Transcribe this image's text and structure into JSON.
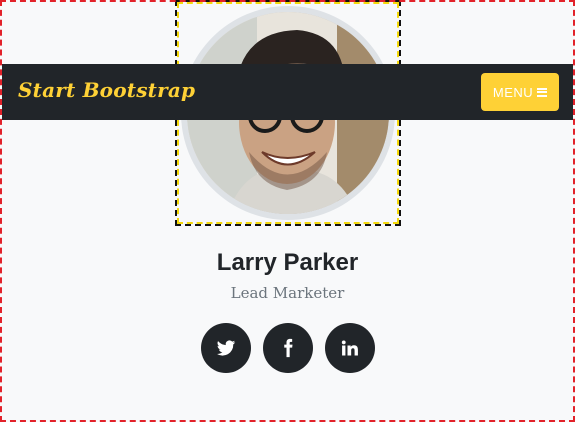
{
  "navbar": {
    "brand": "Start Bootstrap",
    "menu_label": "MENU",
    "menu_icon": "bars-icon"
  },
  "profile": {
    "name": "Larry Parker",
    "role": "Lead Marketer",
    "photo": "portrait-photo"
  },
  "socials": [
    {
      "icon": "twitter-icon"
    },
    {
      "icon": "facebook-icon"
    },
    {
      "icon": "linkedin-icon"
    }
  ],
  "colors": {
    "accent": "#fed136",
    "navbar_bg": "#212529",
    "page_bg": "#f8f9fa",
    "muted_text": "#6c757d"
  }
}
